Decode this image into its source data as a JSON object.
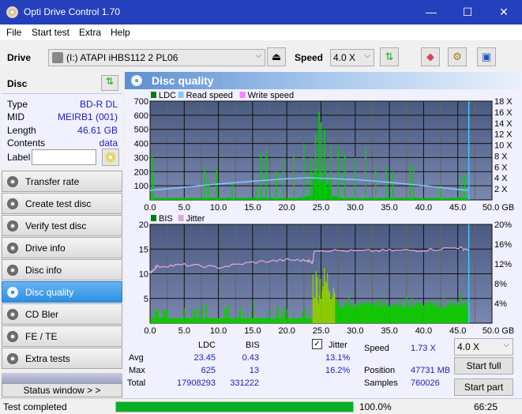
{
  "window": {
    "title": "Opti Drive Control 1.70",
    "minimize": "—",
    "maximize": "☐",
    "close": "✕"
  },
  "menu": [
    "File",
    "Start test",
    "Extra",
    "Help"
  ],
  "toolbar": {
    "drive_label": "Drive",
    "drive_value": "(I:)  ATAPI iHBS112   2 PL06",
    "speed_label": "Speed",
    "speed_value": "4.0 X"
  },
  "disc": {
    "header": "Disc",
    "type_label": "Type",
    "type_value": "BD-R DL",
    "mid_label": "MID",
    "mid_value": "MEIRB1 (001)",
    "length_label": "Length",
    "length_value": "46.61 GB",
    "contents_label": "Contents",
    "contents_value": "data",
    "label_label": "Label",
    "label_value": ""
  },
  "nav": [
    {
      "label": "Transfer rate"
    },
    {
      "label": "Create test disc"
    },
    {
      "label": "Verify test disc"
    },
    {
      "label": "Drive info"
    },
    {
      "label": "Disc info"
    },
    {
      "label": "Disc quality",
      "active": true
    },
    {
      "label": "CD Bler"
    },
    {
      "label": "FE / TE"
    },
    {
      "label": "Extra tests"
    }
  ],
  "status_window_btn": "Status window > >",
  "panel": {
    "title": "Disc quality"
  },
  "chart_data": [
    {
      "type": "bar",
      "title": "LDC",
      "legend": [
        "LDC",
        "Read speed",
        "Write speed"
      ],
      "legend_colors": [
        "#008000",
        "#80c8ff",
        "#ff80ff"
      ],
      "x_ticks": [
        "0.0",
        "5.0",
        "10.0",
        "15.0",
        "20.0",
        "25.0",
        "30.0",
        "35.0",
        "40.0",
        "45.0",
        "50.0 GB"
      ],
      "xlim": [
        0,
        50
      ],
      "y_ticks": [
        "100",
        "200",
        "300",
        "400",
        "500",
        "600",
        "700"
      ],
      "ylim": [
        0,
        700
      ],
      "y2_ticks": [
        "2 X",
        "4 X",
        "6 X",
        "8 X",
        "10 X",
        "12 X",
        "14 X",
        "16 X",
        "18 X"
      ],
      "y2lim": [
        0,
        18
      ],
      "ldc_spikes": [
        [
          0.3,
          320
        ],
        [
          0.5,
          180
        ],
        [
          8,
          230
        ],
        [
          8.5,
          150
        ],
        [
          9.7,
          220
        ],
        [
          12,
          120
        ],
        [
          15.5,
          80
        ],
        [
          16.2,
          330
        ],
        [
          17,
          340
        ],
        [
          18.5,
          200
        ],
        [
          19.5,
          300
        ],
        [
          21,
          330
        ],
        [
          22.5,
          400
        ],
        [
          23.5,
          300
        ],
        [
          24.2,
          470
        ],
        [
          24.7,
          625
        ],
        [
          25,
          550
        ],
        [
          25.5,
          500
        ],
        [
          26.5,
          390
        ],
        [
          27.5,
          380
        ],
        [
          28.5,
          320
        ],
        [
          30,
          300
        ],
        [
          31.5,
          380
        ],
        [
          33,
          250
        ],
        [
          34.5,
          250
        ],
        [
          35.5,
          200
        ],
        [
          38,
          250
        ],
        [
          38.5,
          250
        ],
        [
          42.5,
          100
        ],
        [
          45.5,
          180
        ],
        [
          46,
          180
        ]
      ],
      "read_speed": [
        [
          0,
          1.75
        ],
        [
          5,
          2.3
        ],
        [
          10,
          2.9
        ],
        [
          15,
          3.4
        ],
        [
          20,
          3.85
        ],
        [
          23.5,
          4.05
        ],
        [
          24,
          4.0
        ],
        [
          25,
          3.95
        ],
        [
          30,
          3.7
        ],
        [
          35,
          3.2
        ],
        [
          40,
          2.6
        ],
        [
          45,
          1.9
        ],
        [
          46.6,
          1.73
        ]
      ],
      "end_gb": 46.61
    },
    {
      "type": "bar",
      "title": "BIS",
      "legend": [
        "BIS",
        "Jitter"
      ],
      "legend_colors": [
        "#008000",
        "#d8a8d8"
      ],
      "x_ticks": [
        "0.0",
        "5.0",
        "10.0",
        "15.0",
        "20.0",
        "25.0",
        "30.0",
        "35.0",
        "40.0",
        "45.0",
        "50.0 GB"
      ],
      "xlim": [
        0,
        50
      ],
      "y_ticks": [
        "5",
        "10",
        "15",
        "20"
      ],
      "ylim": [
        0,
        20
      ],
      "y2_ticks": [
        "4%",
        "8%",
        "12%",
        "16%",
        "20%"
      ],
      "y2lim": [
        0,
        20
      ],
      "jitter": [
        [
          0,
          10.2
        ],
        [
          1,
          11.5
        ],
        [
          5,
          11.8
        ],
        [
          10,
          11.3
        ],
        [
          15,
          12.3
        ],
        [
          20,
          12.8
        ],
        [
          23,
          12.7
        ],
        [
          23.8,
          12.3
        ],
        [
          24,
          14.8
        ],
        [
          30,
          14.6
        ],
        [
          35,
          14.7
        ],
        [
          40,
          14.8
        ],
        [
          45,
          15.3
        ],
        [
          46.6,
          14.9
        ]
      ],
      "end_gb": 46.61
    }
  ],
  "stats": {
    "col_ldc": "LDC",
    "col_bis": "BIS",
    "avg_label": "Avg",
    "max_label": "Max",
    "total_label": "Total",
    "avg_ldc": "23.45",
    "avg_bis": "0.43",
    "max_ldc": "625",
    "max_bis": "13",
    "total_ldc": "17908293",
    "total_bis": "331222",
    "jitter_label": "Jitter",
    "jitter_checked": true,
    "jitter_avg": "13.1%",
    "jitter_max": "16.2%",
    "speed_label": "Speed",
    "speed_value": "1.73 X",
    "position_label": "Position",
    "position_value": "47731 MB",
    "samples_label": "Samples",
    "samples_value": "760026",
    "speed_select": "4.0 X",
    "start_full": "Start full",
    "start_part": "Start part"
  },
  "status": {
    "text": "Test completed",
    "progress": 100.0,
    "progress_text": "100.0%",
    "time": "66:25"
  }
}
